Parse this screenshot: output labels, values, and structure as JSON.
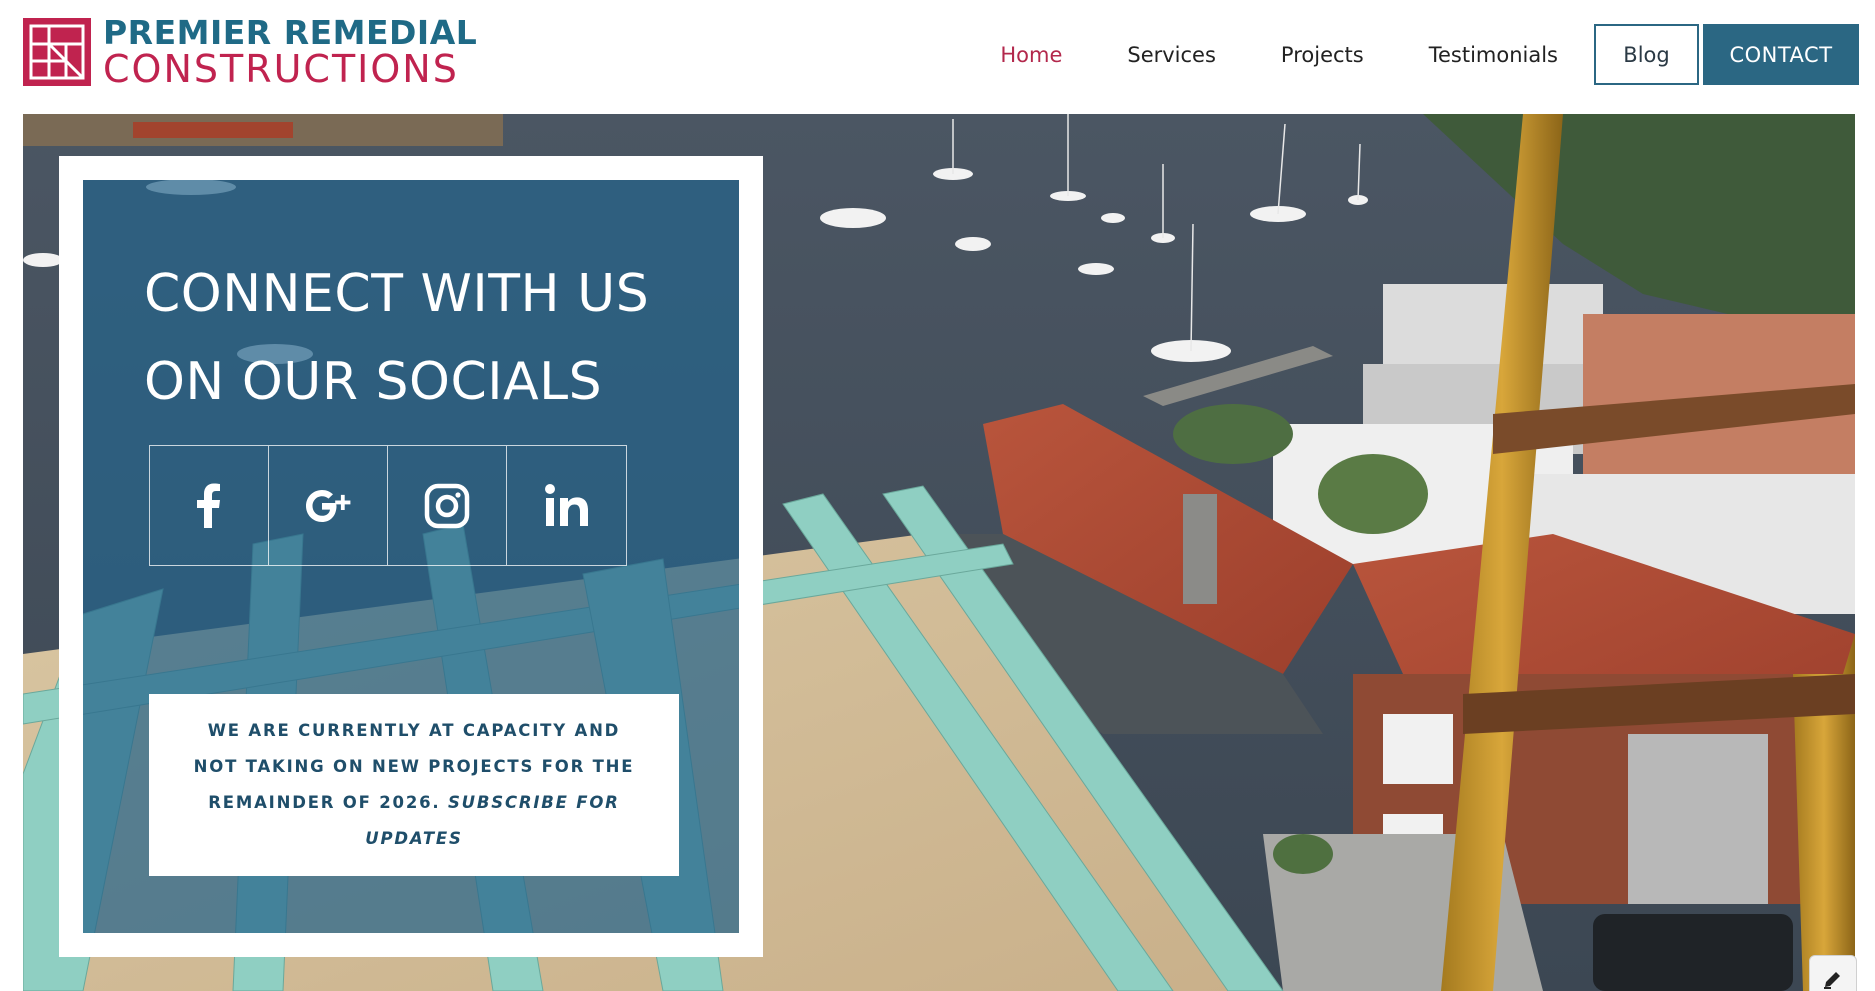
{
  "logo": {
    "line1": "PREMIER REMEDIAL",
    "line2": "CONSTRUCTIONS",
    "icon": "logo-grid-mark",
    "colors": {
      "blue": "#1f6a86",
      "red": "#c0234f"
    }
  },
  "nav": {
    "items": [
      {
        "label": "Home",
        "active": true
      },
      {
        "label": "Services",
        "active": false
      },
      {
        "label": "Projects",
        "active": false
      },
      {
        "label": "Testimonials",
        "active": false
      }
    ],
    "blog_label": "Blog",
    "contact_label": "CONTACT",
    "active_color": "#b3284c",
    "brand_color": "#2b6783"
  },
  "hero": {
    "title": "CONNECT WITH US ON OUR SOCIALS",
    "socials": [
      {
        "icon": "facebook-icon"
      },
      {
        "icon": "google-plus-icon"
      },
      {
        "icon": "instagram-icon"
      },
      {
        "icon": "linkedin-icon"
      }
    ],
    "notice": {
      "text": "WE ARE CURRENTLY AT CAPACITY AND NOT TAKING ON NEW PROJECTS FOR THE REMAINDER OF 2026.",
      "link": "SUBSCRIBE FOR UPDATES"
    },
    "background": "harbour rooftop construction photo"
  },
  "edit_button": {
    "icon": "pencil-icon"
  }
}
